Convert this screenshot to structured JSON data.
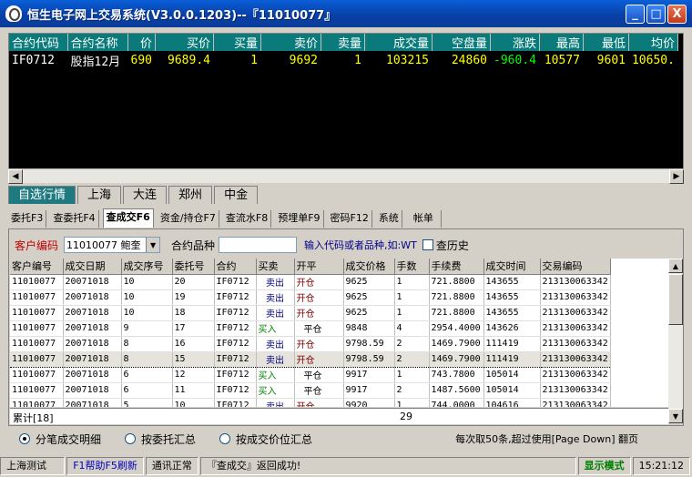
{
  "window": {
    "title": "恒生电子网上交易系统(V3.0.0.1203)--『11010077』",
    "buttons": [
      "_",
      "□",
      "X"
    ]
  },
  "quote": {
    "headers": [
      "合约代码",
      "合约名称",
      "价",
      "买价",
      "买量",
      "卖价",
      "卖量",
      "成交量",
      "空盘量",
      "涨跌",
      "最高",
      "最低",
      "均价"
    ],
    "row": [
      "IF0712",
      "股指12月",
      "690",
      "9689.4",
      "1",
      "9692",
      "1",
      "103215",
      "24860",
      "-960.4",
      "10577",
      "9601",
      "10650."
    ]
  },
  "market_tabs": [
    "自选行情",
    "上海",
    "大连",
    "郑州",
    "中金"
  ],
  "function_tabs": [
    "委托F3",
    "查委托F4",
    "查成交F6",
    "资金/持仓F7",
    "查流水F8",
    "预埋单F9",
    "密码F12",
    "系统",
    "帐单"
  ],
  "filter": {
    "customer_label": "客户编码",
    "customer_value": "11010077 鲍奎",
    "contract_label": "合约品种",
    "contract_value": "",
    "hint": "输入代码或者品种,如:WT",
    "history_label": "查历史"
  },
  "grid": {
    "headers": [
      "客户编号",
      "成交日期",
      "成交序号",
      "委托号",
      "合约",
      "买卖",
      "开平",
      "成交价格",
      "手数",
      "手续费",
      "成交时间",
      "交易编码"
    ],
    "rows": [
      [
        "11010077",
        "20071018",
        "10",
        "20",
        "IF0712",
        "卖出",
        "开仓",
        "9625",
        "1",
        "721.8800",
        "143655",
        "213130063342"
      ],
      [
        "11010077",
        "20071018",
        "10",
        "19",
        "IF0712",
        "卖出",
        "开仓",
        "9625",
        "1",
        "721.8800",
        "143655",
        "213130063342"
      ],
      [
        "11010077",
        "20071018",
        "10",
        "18",
        "IF0712",
        "卖出",
        "开仓",
        "9625",
        "1",
        "721.8800",
        "143655",
        "213130063342"
      ],
      [
        "11010077",
        "20071018",
        "9",
        "17",
        "IF0712",
        "买入",
        "平仓",
        "9848",
        "4",
        "2954.4000",
        "143626",
        "213130063342"
      ],
      [
        "11010077",
        "20071018",
        "8",
        "16",
        "IF0712",
        "卖出",
        "开仓",
        "9798.59",
        "2",
        "1469.7900",
        "111419",
        "213130063342"
      ],
      [
        "11010077",
        "20071018",
        "8",
        "15",
        "IF0712",
        "卖出",
        "开仓",
        "9798.59",
        "2",
        "1469.7900",
        "111419",
        "213130063342"
      ],
      [
        "11010077",
        "20071018",
        "6",
        "12",
        "IF0712",
        "买入",
        "平仓",
        "9917",
        "1",
        "743.7800",
        "105014",
        "213130063342"
      ],
      [
        "11010077",
        "20071018",
        "6",
        "11",
        "IF0712",
        "买入",
        "平仓",
        "9917",
        "2",
        "1487.5600",
        "105014",
        "213130063342"
      ],
      [
        "11010077",
        "20071018",
        "5",
        "10",
        "IF0712",
        "卖出",
        "开仓",
        "9920",
        "1",
        "744.0000",
        "104616",
        "213130063342"
      ]
    ],
    "total_label": "累计[18]",
    "total_qty": "29"
  },
  "radios": [
    "分笔成交明细",
    "按委托汇总",
    "按成交价位汇总"
  ],
  "radio_note": "每次取50条,超过使用[Page Down] 翻页",
  "status": [
    "上海测试",
    "F1帮助F5刷新",
    "通讯正常",
    "『查成交』返回成功!",
    "显示模式",
    "15:21:12"
  ]
}
